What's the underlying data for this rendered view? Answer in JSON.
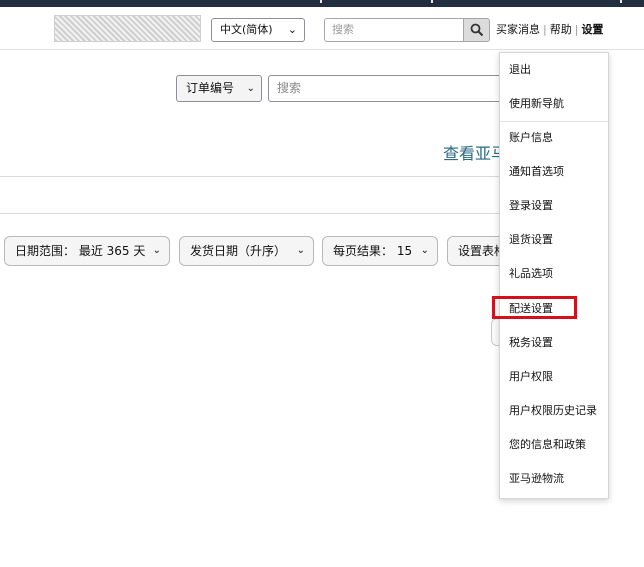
{
  "header": {
    "language": {
      "value": "中文(简体)"
    },
    "search": {
      "placeholder": "搜索"
    },
    "links": {
      "messages": "买家消息",
      "help": "帮助",
      "settings": "设置"
    }
  },
  "order_search": {
    "field_select": "订单编号",
    "placeholder": "搜索",
    "view_link": "查看亚马逊..."
  },
  "filters": {
    "date_range": "日期范围：  最近 365 天",
    "sort": "发货日期（升序）",
    "per_page": "每页结果：  15",
    "table_settings": "设置表格"
  },
  "settings_menu": {
    "items": [
      "退出",
      "使用新导航",
      "账户信息",
      "通知首选项",
      "登录设置",
      "退货设置",
      "礼品选项",
      "配送设置",
      "税务设置",
      "用户权限",
      "用户权限历史记录",
      "您的信息和政策",
      "亚马逊物流"
    ],
    "highlighted_item": "配送设置",
    "highlight_color": "#d4111b"
  },
  "colors": {
    "top_bar": "#232f3e",
    "link": "#2a6a86"
  }
}
